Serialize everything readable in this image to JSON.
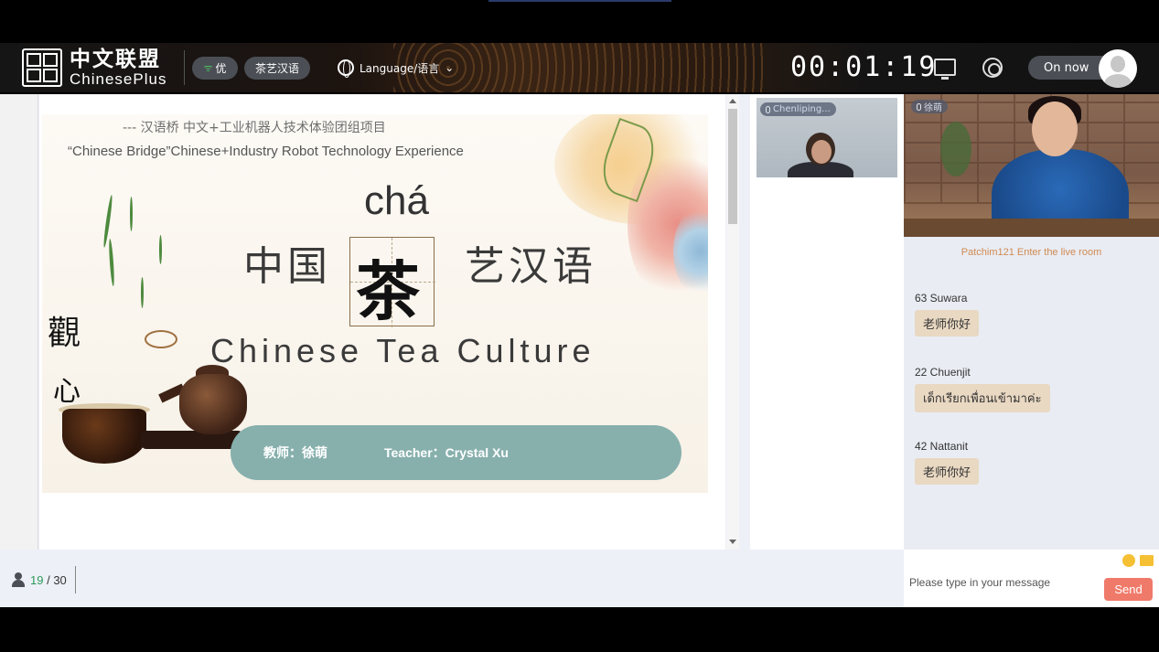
{
  "header": {
    "brand_cn": "中文联盟",
    "brand_en": "ChinesePlus",
    "quality_label": "优",
    "course_label": "茶艺汉语",
    "language_label": "Language/语言",
    "timer": "00:01:19",
    "status_label": "On now"
  },
  "slide": {
    "subtitle_cn": "--- 汉语桥 中文+工业机器人技术体验团组项目",
    "subtitle_en": "“Chinese Bridge”Chinese+Industry Robot Technology Experience",
    "pinyin": "chá",
    "title_left": "中国",
    "title_char": "茶",
    "title_right": "艺汉语",
    "title_en": "Chinese Tea Culture",
    "teacher_cn": "教师：徐萌",
    "teacher_en": "Teacher：Crystal Xu"
  },
  "videos": {
    "student_name": "Chenliping...",
    "teacher_name": "徐萌"
  },
  "chat": {
    "system_message": "Patchim121 Enter the live room",
    "messages": [
      {
        "name": "63 Suwara",
        "text": "老师你好"
      },
      {
        "name": "22 Chuenjit",
        "text": "เด็กเรียกเพื่อนเข้ามาค่ะ"
      },
      {
        "name": "42 Nattanit",
        "text": "老师你好"
      }
    ],
    "input_placeholder": "Please type in your message",
    "send_label": "Send"
  },
  "footer": {
    "online_count": "19",
    "total_count": "/ 30"
  },
  "colors": {
    "accent": "#f07a6a",
    "teacher_bar": "#87b0ad",
    "system_text": "#d08a52",
    "online_green": "#2b9a5a"
  }
}
